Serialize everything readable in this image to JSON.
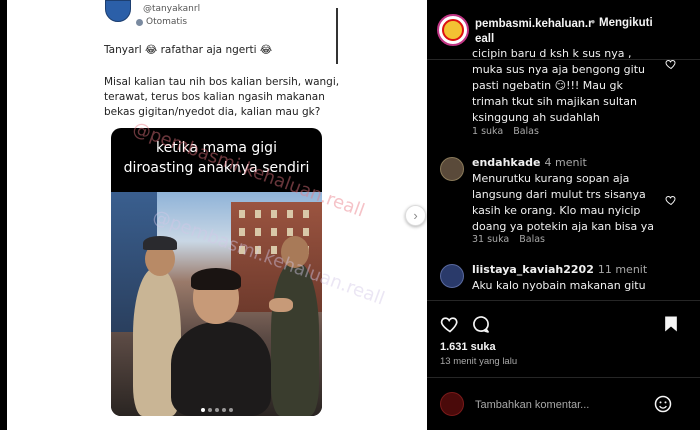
{
  "post": {
    "handle": "@tanyakanrl",
    "auto_label": "Otomatis",
    "line1": "Tanyarl 😂 rafathar aja ngerti 😂",
    "line2": "Misal kalian tau nih bos kalian bersih, wangi, terawat, terus bos kalian ngasih makanan bekas gigitan/nyedot dia, kalian mau gk?",
    "embed_caption": "ketika mama gigi diroasting anaknya sendiri",
    "watermark": "@pembasmi.kehaluan.reall"
  },
  "panel": {
    "username": "pembasmi.kehaluan.reall",
    "follow_label": "Mengikuti"
  },
  "comments": [
    {
      "text_top": "cicipin baru d ksh k sus nya , muka sus nya aja bengong gitu pasti ngebatin 😏!!! Mau gk trimah tkut sih majikan sultan ksinggung ah sudahlah",
      "likes": "1 suka",
      "reply": "Balas"
    },
    {
      "user": "endahkade",
      "time": "4 menit",
      "text": "Menurutku kurang sopan aja langsung dari mulut trs sisanya kasih ke orang. Klo mau nyicip doang ya potekin aja kan bisa ya",
      "likes": "31 suka",
      "reply": "Balas"
    },
    {
      "user": "liistaya_kaviah2202",
      "time": "11 menit",
      "text": "Aku kalo nyobain makanan gitu kan pas ada suami, malahan suami ku"
    }
  ],
  "actions": {
    "likes": "1.631 suka",
    "ago": "13 menit yang lalu",
    "comment_placeholder": "Tambahkan komentar..."
  }
}
